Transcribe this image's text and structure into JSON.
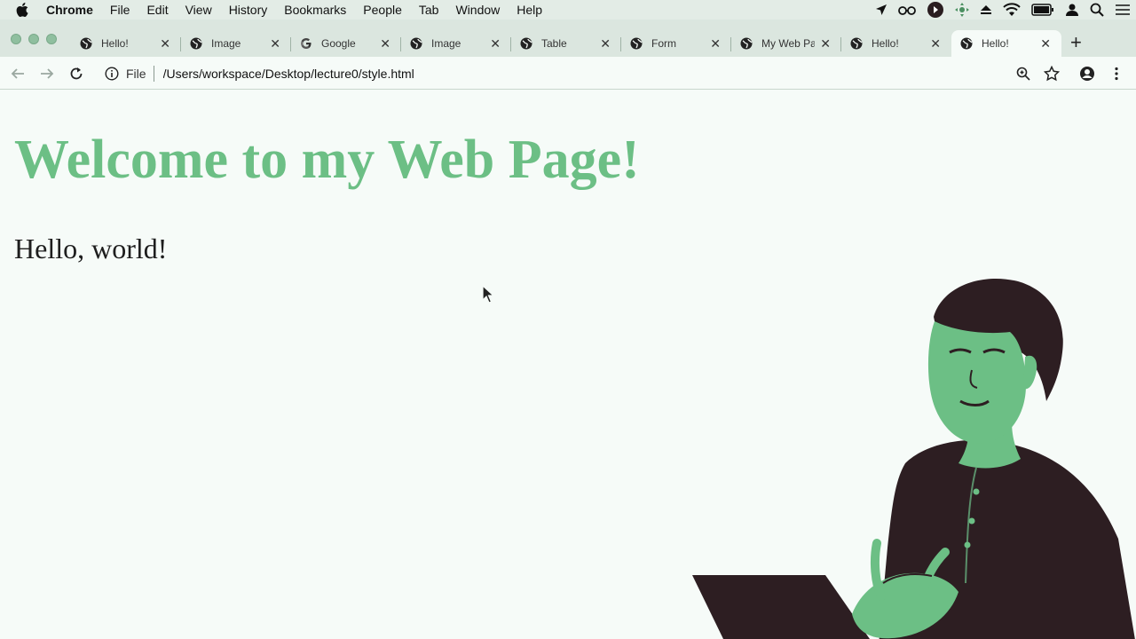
{
  "menubar": {
    "items": [
      "Chrome",
      "File",
      "Edit",
      "View",
      "History",
      "Bookmarks",
      "People",
      "Tab",
      "Window",
      "Help"
    ],
    "status_icons": [
      "location-icon",
      "glasses-icon",
      "play-icon",
      "move-icon",
      "eject-icon",
      "wifi-icon",
      "battery-icon",
      "user-icon",
      "spotlight-search-icon",
      "notification-center-icon"
    ]
  },
  "tabs": [
    {
      "label": "Hello!",
      "favicon": "globe-icon"
    },
    {
      "label": "Image",
      "favicon": "globe-icon"
    },
    {
      "label": "Google",
      "favicon": "google-icon"
    },
    {
      "label": "Image",
      "favicon": "globe-icon"
    },
    {
      "label": "Table",
      "favicon": "globe-icon"
    },
    {
      "label": "Form",
      "favicon": "globe-icon"
    },
    {
      "label": "My Web Pa",
      "favicon": "globe-icon"
    },
    {
      "label": "Hello!",
      "favicon": "globe-icon"
    },
    {
      "label": "Hello!",
      "favicon": "globe-icon",
      "active": true
    }
  ],
  "toolbar": {
    "scheme": "File",
    "url": "/Users/workspace/Desktop/lecture0/style.html"
  },
  "page": {
    "heading": "Welcome to my Web Page!",
    "paragraph": "Hello, world!"
  },
  "colors": {
    "heading": "#6cbf85",
    "background": "#f6fbf8",
    "presenter": "#2d1e22"
  }
}
